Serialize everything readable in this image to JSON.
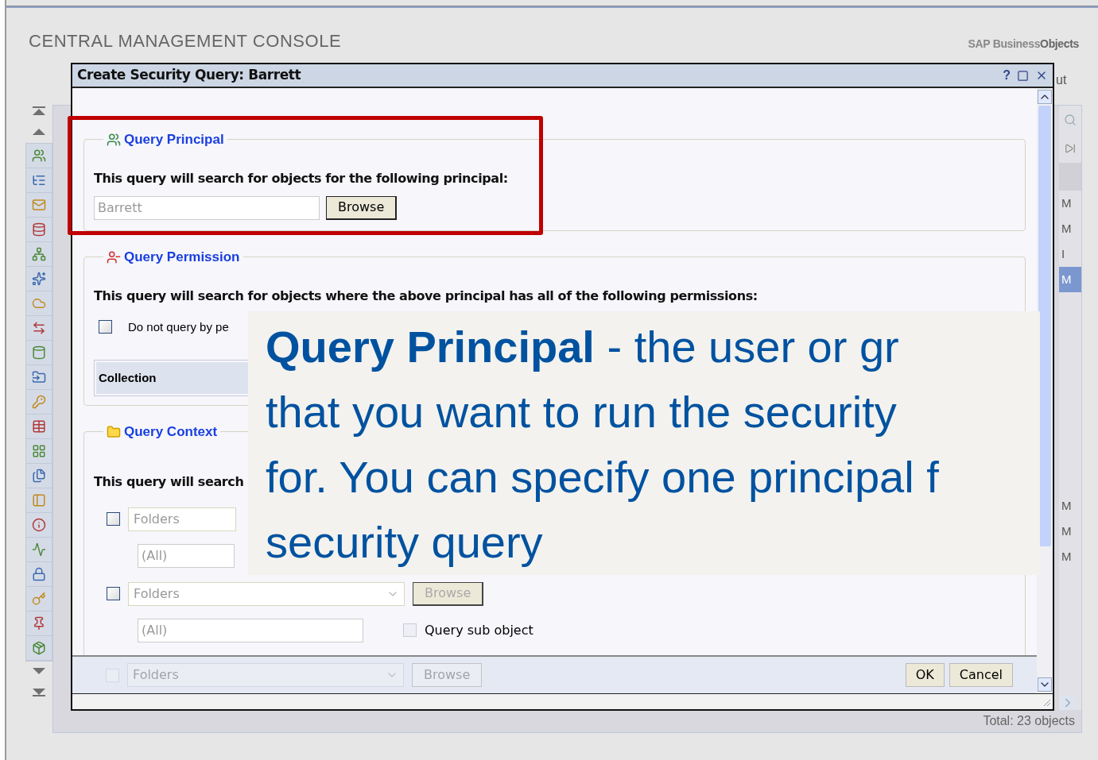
{
  "app": {
    "title": "CENTRAL MANAGEMENT CONSOLE",
    "logo_light": "SAP Business",
    "logo_bold": "Objects",
    "header_link": "ut"
  },
  "background": {
    "rows_upper": [
      {
        "text": "M",
        "selected": false
      },
      {
        "text": "M",
        "selected": false
      },
      {
        "text": "I",
        "selected": false
      },
      {
        "text": "M",
        "selected": true
      }
    ],
    "rows_lower": [
      {
        "text": "M",
        "selected": false
      },
      {
        "text": "M",
        "selected": false
      },
      {
        "text": "M",
        "selected": false
      }
    ],
    "status": "Total: 23 objects"
  },
  "dialog": {
    "title": "Create Security Query: Barrett",
    "help": "?",
    "principal": {
      "title": "Query Principal",
      "prompt": "This query will search for objects for the following principal:",
      "value": "Barrett",
      "button": "Browse",
      "highlighted": true
    },
    "permission": {
      "title": "Query Permission",
      "prompt": "This query will search for objects where the above principal has all of the following permissions:",
      "checkbox": {
        "label": "Do not query by pe",
        "checked": false
      },
      "table": {
        "columns": [
          "Collection"
        ]
      }
    },
    "context": {
      "title": "Query Context",
      "prompt": "This query will search",
      "rows": [
        {
          "checked": false,
          "type": "Folders",
          "button": null,
          "path": "(All)",
          "sub": null,
          "disabled": false
        },
        {
          "checked": false,
          "type": "Folders",
          "button": "Browse",
          "path": "(All)",
          "sub": {
            "label": "Query sub object",
            "checked": false
          },
          "disabled": false
        },
        {
          "checked": false,
          "type": "Folders",
          "button": "Browse",
          "path": null,
          "sub": null,
          "disabled": true
        }
      ]
    },
    "buttons": [
      "OK",
      "Cancel"
    ]
  },
  "caption": {
    "lines": [
      "**Query Principal** - the user or gr",
      "that you want to run the security",
      "for. You can specify one principal f",
      "security query"
    ]
  }
}
